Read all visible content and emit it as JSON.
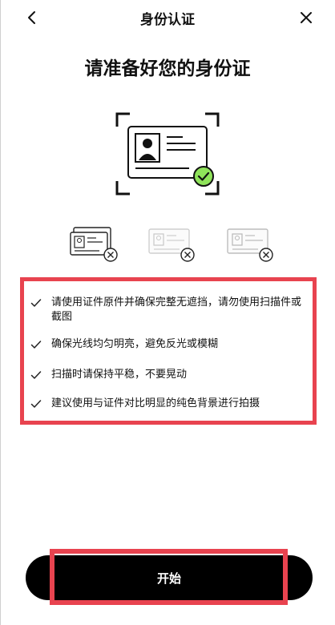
{
  "nav": {
    "title": "身份认证",
    "back_icon": "chevron-left-icon",
    "close_icon": "close-icon"
  },
  "headline": "请准备好您的身份证",
  "tips": [
    {
      "text": "请使用证件原件并确保完整无遮挡，请勿使用扫描件或截图"
    },
    {
      "text": "确保光线均匀明亮，避免反光或模糊"
    },
    {
      "text": "扫描时请保持平稳，不要晃动"
    },
    {
      "text": "建议使用与证件对比明显的纯色背景进行拍摄"
    }
  ],
  "button": {
    "label": "开始"
  },
  "colors": {
    "accent_green": "#8fe35a",
    "highlight_red": "#e8434f",
    "button_bg": "#000000"
  }
}
